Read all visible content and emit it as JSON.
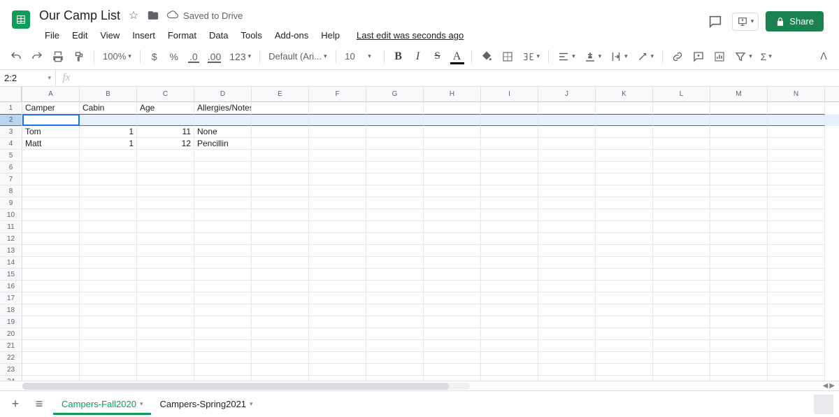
{
  "doc": {
    "title": "Our Camp List",
    "drive_status": "Saved to Drive",
    "last_edit": "Last edit was seconds ago"
  },
  "menus": [
    "File",
    "Edit",
    "View",
    "Insert",
    "Format",
    "Data",
    "Tools",
    "Add-ons",
    "Help"
  ],
  "share_label": "Share",
  "toolbar": {
    "zoom": "100%",
    "font": "Default (Ari...",
    "font_size": "10",
    "decimal_dec": ".0",
    "decimal_inc": ".00",
    "more_formats": "123"
  },
  "namebox": "2:2",
  "columns": [
    "A",
    "B",
    "C",
    "D",
    "E",
    "F",
    "G",
    "H",
    "I",
    "J",
    "K",
    "L",
    "M",
    "N"
  ],
  "row_count": 25,
  "selected_row": 2,
  "rows": {
    "1": {
      "A": "Camper",
      "B": "Cabin",
      "C": "Age",
      "D": "Allergies/Notes"
    },
    "3": {
      "A": "Tom",
      "B": "1",
      "C": "11",
      "D": "None"
    },
    "4": {
      "A": "Matt",
      "B": "1",
      "C": "12",
      "D": "Pencillin"
    }
  },
  "sheets": [
    {
      "name": "Campers-Fall2020",
      "active": true
    },
    {
      "name": "Campers-Spring2021",
      "active": false
    }
  ]
}
